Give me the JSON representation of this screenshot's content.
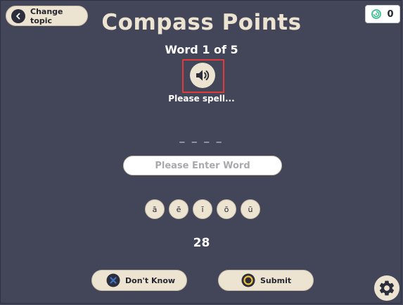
{
  "header": {
    "change_topic_label": "Change topic",
    "title": "Compass Points",
    "score": "0"
  },
  "quiz": {
    "word_counter": "Word 1 of 5",
    "prompt": "Please spell...",
    "blanks": "_ _ _ _",
    "input_placeholder": "Please Enter Word",
    "input_value": "",
    "vowel_keys": [
      "ā",
      "ē",
      "ī",
      "ō",
      "ū"
    ],
    "timer": "28"
  },
  "actions": {
    "dont_know_label": "Don't Know",
    "submit_label": "Submit"
  },
  "icons": {
    "back": "chevron-left-icon",
    "score": "swirl-icon",
    "audio": "speaker-icon",
    "dont_know": "close-icon",
    "submit": "circle-icon",
    "settings": "gear-icon"
  },
  "colors": {
    "background": "#434659",
    "accent_cream": "#ede3d1",
    "dark_icon": "#2c2e3b",
    "dont_know_blue": "#3b73c8",
    "submit_yellow": "#f2c13a",
    "score_green": "#3bbf8e",
    "highlight_red": "#e03a3a"
  }
}
